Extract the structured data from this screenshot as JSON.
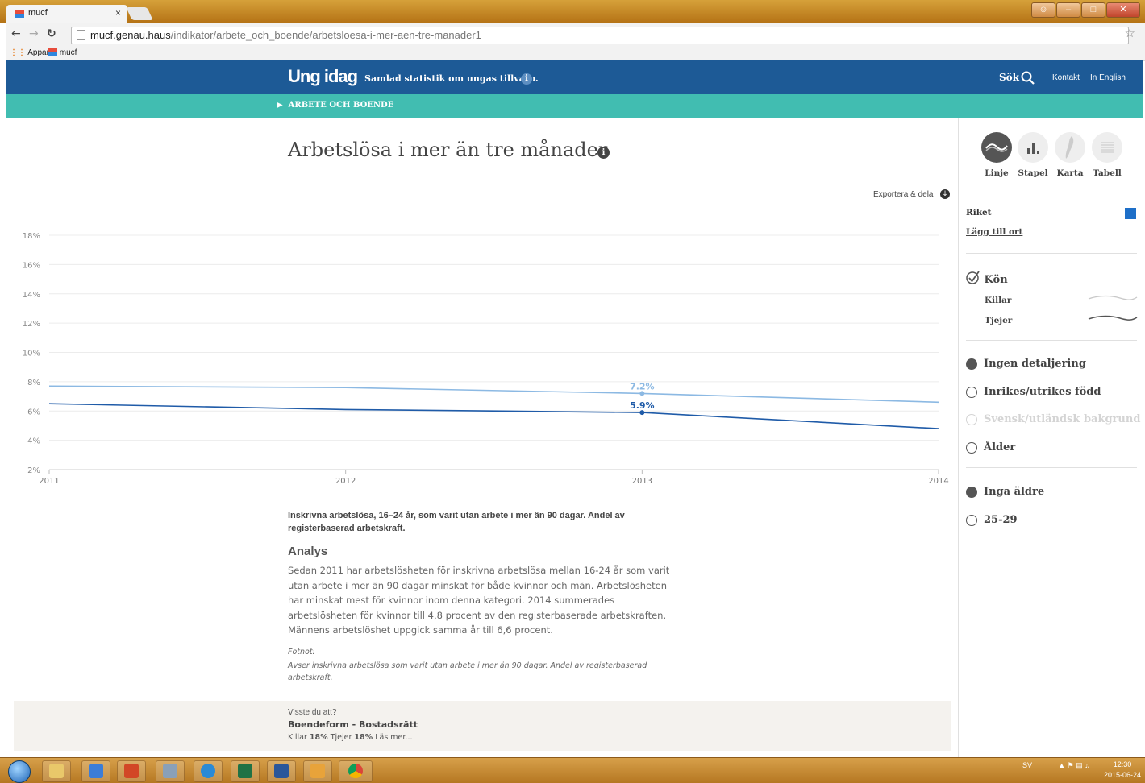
{
  "browser": {
    "tab_title": "mucf",
    "tab_close": "×",
    "url_host": "mucf.genau.haus",
    "url_path": "/indikator/arbete_och_boende/arbetsloesa-i-mer-aen-tre-manader1",
    "bookmarks": [
      "Appar",
      "mucf"
    ]
  },
  "site": {
    "logo": "Ung idag",
    "tagline": "Samlad statistik om ungas tillvaro.",
    "search_label": "Sök",
    "contact": "Kontakt",
    "english": "In English",
    "breadcrumb": "ARBETE OCH BOENDE"
  },
  "page": {
    "title": "Arbetslösa i mer än tre månader",
    "export": "Exportera & dela",
    "caption": "Inskrivna arbetslösa, 16–24 år, som varit utan arbete i mer än 90 dagar. Andel av registerbaserad arbetskraft.",
    "analys_heading": "Analys",
    "analys_text": "Sedan 2011 har arbetslösheten för inskrivna arbetslösa mellan 16-24 år som varit utan arbete i mer än 90 dagar minskat för både kvinnor och män. Arbetslösheten har minskat mest för kvinnor inom denna kategori. 2014 summerades arbetslösheten för kvinnor till 4,8 procent av den registerbaserade arbetskraften. Männens arbetslöshet uppgick samma år till 6,6 procent.",
    "fotnot_heading": "Fotnot:",
    "fotnot_text": "Avser inskrivna arbetslösa som varit utan arbete i mer än 90 dagar. Andel av registerbaserad arbetskraft.",
    "visste_q": "Visste du att?",
    "visste_title": "Boendeform - Bostadsrätt",
    "visste_k_label": "Killar",
    "visste_k_val": "18%",
    "visste_t_label": "Tjejer",
    "visste_t_val": "18%",
    "visste_more": "Läs mer..."
  },
  "chart_data": {
    "type": "line",
    "x": [
      "2011",
      "2012",
      "2013",
      "2014"
    ],
    "ylim": [
      2,
      18
    ],
    "yticks": [
      "2%",
      "4%",
      "6%",
      "8%",
      "10%",
      "12%",
      "14%",
      "16%",
      "18%"
    ],
    "series": [
      {
        "name": "Killar",
        "color": "#8cb9e3",
        "values": [
          7.7,
          7.6,
          7.2,
          6.6
        ]
      },
      {
        "name": "Tjejer",
        "color": "#1f5ba8",
        "values": [
          6.5,
          6.1,
          5.9,
          4.8
        ]
      }
    ],
    "annotations": [
      {
        "x": "2013",
        "series": "Killar",
        "label": "7.2%"
      },
      {
        "x": "2013",
        "series": "Tjejer",
        "label": "5.9%"
      }
    ],
    "grid": true
  },
  "sidebar": {
    "views": [
      {
        "label": "Linje",
        "icon": "line-chart-icon",
        "active": true
      },
      {
        "label": "Stapel",
        "icon": "bar-chart-icon",
        "active": false
      },
      {
        "label": "Karta",
        "icon": "map-icon",
        "active": false
      },
      {
        "label": "Tabell",
        "icon": "table-icon",
        "active": false
      }
    ],
    "region": "Riket",
    "region_color": "#1e6fc8",
    "add_place": "Lägg till ort",
    "kon": "Kön",
    "kon_items": [
      "Killar",
      "Tjejer"
    ],
    "detail_options": [
      {
        "label": "Ingen detaljering",
        "selected": true,
        "disabled": false
      },
      {
        "label": "Inrikes/utrikes född",
        "selected": false,
        "disabled": false
      },
      {
        "label": "Svensk/utländsk bakgrund",
        "selected": false,
        "disabled": true
      },
      {
        "label": "Ålder",
        "selected": false,
        "disabled": false
      }
    ],
    "age_options": [
      {
        "label": "Inga äldre",
        "selected": true
      },
      {
        "label": "25-29",
        "selected": false
      }
    ]
  },
  "taskbar": {
    "lang": "SV",
    "time": "12:30",
    "date": "2015-06-24"
  }
}
